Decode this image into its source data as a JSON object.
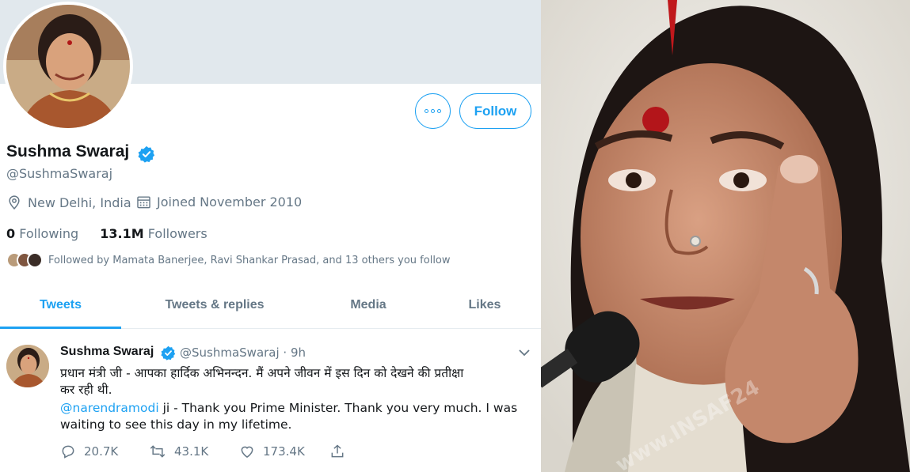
{
  "profile": {
    "name": "Sushma Swaraj",
    "handle": "@SushmaSwaraj",
    "location": "New Delhi, India",
    "joined": "Joined November 2010",
    "following_count": "0",
    "following_label": "Following",
    "followers_count": "13.1M",
    "followers_label": "Followers",
    "followed_by": "Followed by Mamata Banerjee, Ravi Shankar Prasad, and 13 others you follow",
    "follow_label": "Follow"
  },
  "tabs": [
    "Tweets",
    "Tweets & replies",
    "Media",
    "Likes"
  ],
  "tweet": {
    "name": "Sushma Swaraj",
    "handle_time": "@SushmaSwaraj · 9h",
    "text_hindi_line1": "प्रधान मंत्री जी - आपका हार्दिक अभिनन्दन. मैं अपने जीवन में इस दिन को देखने की प्रतीक्षा",
    "text_hindi_line2": "कर रही थी.",
    "mention": "@narendramodi",
    "text_english_rest": " ji - Thank you Prime Minister. Thank you very much. I was",
    "text_english_line2": "waiting to see this day in my lifetime.",
    "replies": "20.7K",
    "retweets": "43.1K",
    "likes": "173.4K"
  },
  "photo": {
    "watermark": "www.INSAF24"
  },
  "colors": {
    "accent": "#1da1f2",
    "banner": "#e1e8ed",
    "muted": "#657786"
  },
  "icons": [
    "location-icon",
    "calendar-icon",
    "verified-badge-icon",
    "chevron-down-icon",
    "reply-icon",
    "retweet-icon",
    "like-icon",
    "share-icon",
    "more-icon"
  ]
}
